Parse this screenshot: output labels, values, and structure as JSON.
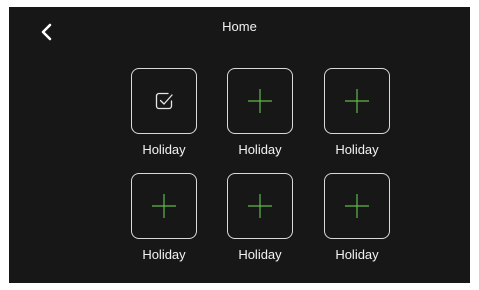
{
  "header": {
    "title": "Home",
    "back_icon": "chevron-left-icon"
  },
  "colors": {
    "background": "#171717",
    "tile_border": "#d9d9d9",
    "plus_accent": "#5fb94a",
    "text": "#f2f2f2"
  },
  "tiles": [
    {
      "label": "Holiday",
      "icon": "checkbox-checked-icon",
      "selected": true
    },
    {
      "label": "Holiday",
      "icon": "plus-icon",
      "selected": false
    },
    {
      "label": "Holiday",
      "icon": "plus-icon",
      "selected": false
    },
    {
      "label": "Holiday",
      "icon": "plus-icon",
      "selected": false
    },
    {
      "label": "Holiday",
      "icon": "plus-icon",
      "selected": false
    },
    {
      "label": "Holiday",
      "icon": "plus-icon",
      "selected": false
    }
  ]
}
